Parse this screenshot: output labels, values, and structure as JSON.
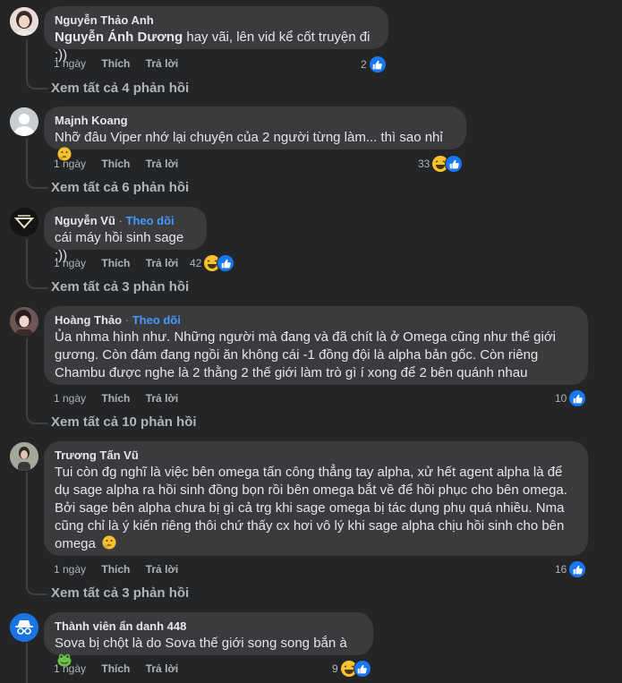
{
  "actions": {
    "time": "1 ngày",
    "like": "Thích",
    "reply": "Trả lời"
  },
  "follow_label": "Theo dõi",
  "separator": "·",
  "colors": {
    "background": "#242526",
    "bubble": "#3a3b3c",
    "like_blue": "#1877f2",
    "follow_blue": "#4599ff",
    "muted": "#b0b3b8"
  },
  "comments": [
    {
      "author": "Nguyễn Thảo Anh",
      "mention": "Nguyễn Ánh Dương",
      "text": " hay vãi, lên vid kể cốt truyện đi :))",
      "reaction_count": "2",
      "reactions": [
        "like"
      ],
      "view_replies": "Xem tất cả 4 phản hồi"
    },
    {
      "author": "Majnh Koang",
      "text": "Nhỡ đâu Viper nhớ lại chuyện của 2 người từng làm... thì sao nhỉ",
      "emoji": "thinking-face",
      "reaction_count": "33",
      "reactions": [
        "haha",
        "like"
      ],
      "view_replies": "Xem tất cả 6 phản hồi"
    },
    {
      "author": "Nguyễn Vũ",
      "following": true,
      "text": "cái máy hồi sinh sage :))",
      "reaction_count": "42",
      "reactions": [
        "haha",
        "like"
      ],
      "view_replies": "Xem tất cả 3 phản hồi"
    },
    {
      "author": "Hoàng Thảo",
      "following": true,
      "lines": [
        "Ủa nhma hình như. Những người mà đang và đã chít là ở Omega cũng như thế giới",
        "gương. Còn đám đang ngồi ăn không cái -1 đồng đội là alpha bản gốc. Còn riêng",
        "Chambu được nghe là 2 thằng 2 thế giới làm trò gì í xong để 2 bên quánh nhau"
      ],
      "reaction_count": "10",
      "reactions": [
        "like"
      ],
      "view_replies": "Xem tất cả 10 phản hồi"
    },
    {
      "author": "Trương Tấn Vũ",
      "lines": [
        "Tui còn đg nghĩ là việc bên omega tấn công thẳng tay alpha, xử hết agent alpha là để",
        "dụ sage alpha ra hồi sinh đồng bọn rồi bên omega bắt về để hồi phục cho bên omega.",
        "Bởi sage bên alpha chưa bị gì cả trg khi sage omega bị tác dụng phụ quá nhiều. Nma",
        "cũng chỉ là ý kiến riêng thôi chứ thấy cx hơi vô lý khi sage alpha chịu hồi sinh cho bên",
        "omega"
      ],
      "emoji": "thinking-face",
      "reaction_count": "16",
      "reactions": [
        "like"
      ],
      "view_replies": "Xem tất cả 3 phản hồi"
    },
    {
      "author": "Thành viên ẩn danh 448",
      "text": "Sova bị chột là do Sova thế giới song song bắn à",
      "emoji": "frog-face",
      "reaction_count": "9",
      "reactions": [
        "haha",
        "like"
      ]
    }
  ]
}
